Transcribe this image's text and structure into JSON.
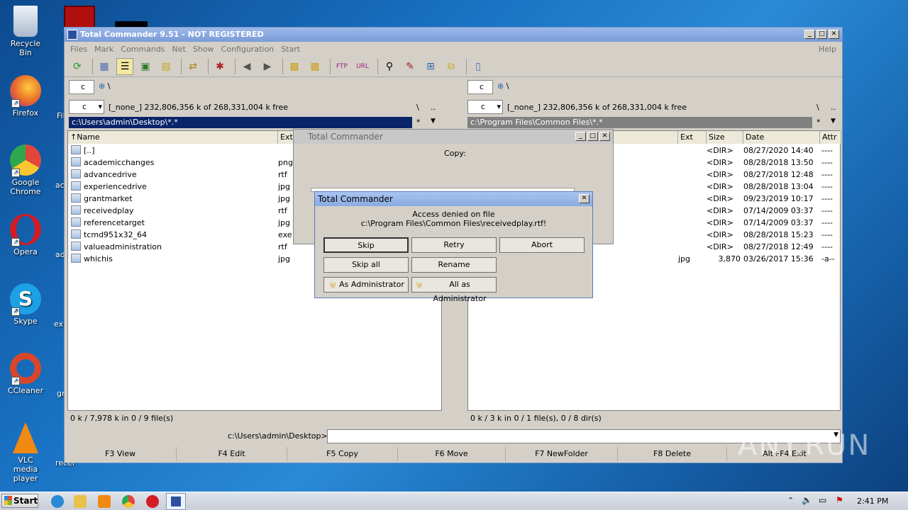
{
  "desktop": {
    "icons": [
      {
        "label": "Recycle Bin",
        "icon": "recycle-bin-icon",
        "color": "#cfd8e6"
      },
      {
        "label": "Firefox",
        "icon": "firefox-icon",
        "color": "#e8672a"
      },
      {
        "label": "Google Chrome",
        "icon": "chrome-icon",
        "color": "#e0463a"
      },
      {
        "label": "Opera",
        "icon": "opera-icon",
        "color": "#d41b24"
      },
      {
        "label": "Skype",
        "icon": "skype-icon",
        "color": "#1da1e6"
      },
      {
        "label": "CCleaner",
        "icon": "ccleaner-icon",
        "color": "#d9462c"
      },
      {
        "label": "VLC media player",
        "icon": "vlc-icon",
        "color": "#f08a12"
      }
    ],
    "partial_labels": [
      "Fil",
      "aca",
      "ad",
      "exp",
      "gr",
      "recei"
    ]
  },
  "window": {
    "title": "Total Commander 9.51 - NOT REGISTERED",
    "minimize": "_",
    "maximize": "□",
    "close": "✕"
  },
  "menu": [
    "Files",
    "Mark",
    "Commands",
    "Net",
    "Show",
    "Configuration",
    "Start"
  ],
  "help": "Help",
  "left": {
    "drive_tab": "c",
    "root": "\\",
    "drive": "c",
    "freespace": "[_none_]  232,806,356 k of 268,331,004 k free",
    "sep": "\\",
    "updir": "..",
    "path": "c:\\Users\\admin\\Desktop\\*.*",
    "star": "*",
    "arrow": "▼",
    "headers": {
      "name": "Name",
      "ext": "Ext"
    },
    "files": [
      {
        "name": "[..]",
        "ext": ""
      },
      {
        "name": "academicchanges",
        "ext": "png"
      },
      {
        "name": "advancedrive",
        "ext": "rtf"
      },
      {
        "name": "experiencedrive",
        "ext": "jpg"
      },
      {
        "name": "grantmarket",
        "ext": "jpg"
      },
      {
        "name": "receivedplay",
        "ext": "rtf"
      },
      {
        "name": "referencetarget",
        "ext": "jpg"
      },
      {
        "name": "tcmd951x32_64",
        "ext": "exe"
      },
      {
        "name": "valueadministration",
        "ext": "rtf"
      },
      {
        "name": "whichis",
        "ext": "jpg"
      }
    ],
    "status": "0 k / 7,978 k in 0 / 9 file(s)"
  },
  "right": {
    "drive_tab": "c",
    "root": "\\",
    "drive": "c",
    "freespace": "[_none_]  232,806,356 k of 268,331,004 k free",
    "sep": "\\",
    "updir": "..",
    "path": "c:\\Program Files\\Common Files\\*.*",
    "star": "*",
    "arrow": "▼",
    "headers": {
      "ext": "Ext",
      "size": "Size",
      "date": "Date",
      "attr": "Attr"
    },
    "rows": [
      {
        "ext": "",
        "size": "<DIR>",
        "date": "08/27/2020 14:40",
        "attr": "----"
      },
      {
        "ext": "",
        "size": "<DIR>",
        "date": "08/28/2018 13:50",
        "attr": "----"
      },
      {
        "ext": "",
        "size": "<DIR>",
        "date": "08/27/2018 12:48",
        "attr": "----"
      },
      {
        "ext": "",
        "size": "<DIR>",
        "date": "08/28/2018 13:04",
        "attr": "----"
      },
      {
        "ext": "",
        "size": "<DIR>",
        "date": "09/23/2019 10:17",
        "attr": "----"
      },
      {
        "ext": "",
        "size": "<DIR>",
        "date": "07/14/2009 03:37",
        "attr": "----"
      },
      {
        "ext": "",
        "size": "<DIR>",
        "date": "07/14/2009 03:37",
        "attr": "----"
      },
      {
        "ext": "",
        "size": "<DIR>",
        "date": "08/28/2018 15:23",
        "attr": "----"
      },
      {
        "ext": "",
        "size": "<DIR>",
        "date": "08/27/2018 12:49",
        "attr": "----"
      },
      {
        "ext": "jpg",
        "size": "3,870",
        "date": "03/26/2017 15:36",
        "attr": "-a--"
      }
    ],
    "status": "0 k / 3 k in 0 / 1 file(s), 0 / 8 dir(s)"
  },
  "cmdline": {
    "prompt": "c:\\Users\\admin\\Desktop>",
    "value": ""
  },
  "fkeys": [
    "F3 View",
    "F4 Edit",
    "F5 Copy",
    "F6 Move",
    "F7 NewFolder",
    "F8 Delete",
    "Alt+F4 Exit"
  ],
  "copy_dialog": {
    "title": "Total Commander",
    "label": "Copy:"
  },
  "error_dialog": {
    "title": "Total Commander",
    "line1": "Access denied on file",
    "line2": "c:\\Program Files\\Common Files\\receivedplay.rtf!",
    "buttons": {
      "skip": "Skip",
      "retry": "Retry",
      "abort": "Abort",
      "skip_all": "Skip all",
      "rename": "Rename",
      "as_admin": "As Administrator",
      "all_as_admin": "All as Administrator"
    }
  },
  "taskbar": {
    "start": "Start",
    "clock": "2:41 PM"
  },
  "watermark": "ANY.RUN"
}
